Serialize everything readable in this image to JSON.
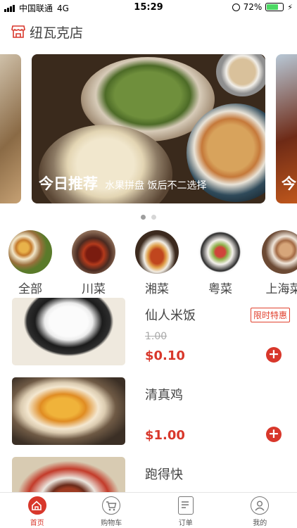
{
  "status_bar": {
    "carrier": "中国联通",
    "network": "4G",
    "time": "15:29",
    "battery_percent": "72%",
    "battery_level": 0.72
  },
  "header": {
    "title": "纽瓦克店",
    "icon": "store-icon",
    "accent_color": "#d8372b"
  },
  "banner": {
    "slides": [
      {
        "title": "今日推荐",
        "subtitle": "水果拼盘 饭后不二选择"
      },
      {
        "title": "今"
      }
    ],
    "active_index": 0,
    "page_count": 2
  },
  "categories": [
    {
      "label": "全部"
    },
    {
      "label": "川菜"
    },
    {
      "label": "湘菜"
    },
    {
      "label": "粤菜"
    },
    {
      "label": "上海菜"
    }
  ],
  "products": [
    {
      "name": "仙人米饭",
      "badge": "限时特惠",
      "old_price": "1.00",
      "price": "$0.10"
    },
    {
      "name": "清真鸡",
      "price": "$1.00"
    },
    {
      "name": "跑得快"
    }
  ],
  "tabbar": {
    "tabs": [
      {
        "label": "首页",
        "icon": "home-icon",
        "active": true
      },
      {
        "label": "购物车",
        "icon": "cart-icon",
        "active": false
      },
      {
        "label": "订单",
        "icon": "order-icon",
        "active": false
      },
      {
        "label": "我的",
        "icon": "user-icon",
        "active": false
      }
    ]
  }
}
